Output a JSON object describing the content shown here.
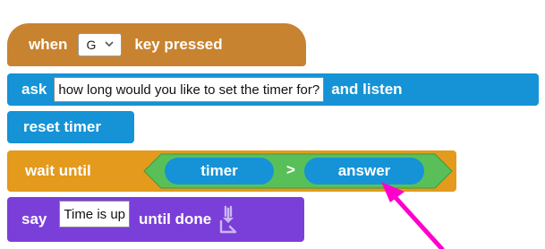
{
  "hat_block": {
    "prefix": "when",
    "key_value": "G",
    "suffix": "key pressed",
    "color": "#C88330"
  },
  "ask_block": {
    "prefix": "ask",
    "question": "how long would you like to set the timer for?",
    "suffix": "and listen",
    "color": "#1593D6"
  },
  "reset_block": {
    "label": "reset timer",
    "color": "#1593D6"
  },
  "wait_block": {
    "prefix": "wait until",
    "condition": {
      "left": "timer",
      "operator": ">",
      "right": "answer"
    },
    "color": "#E49A1C",
    "operator_color": "#59C059"
  },
  "say_block": {
    "prefix": "say",
    "message": "Time is up",
    "suffix": "until done",
    "icon": "speech-icon",
    "color": "#7A3FD9"
  },
  "annotation": {
    "icon": "pink-arrow-icon",
    "color": "#FF00CC"
  }
}
